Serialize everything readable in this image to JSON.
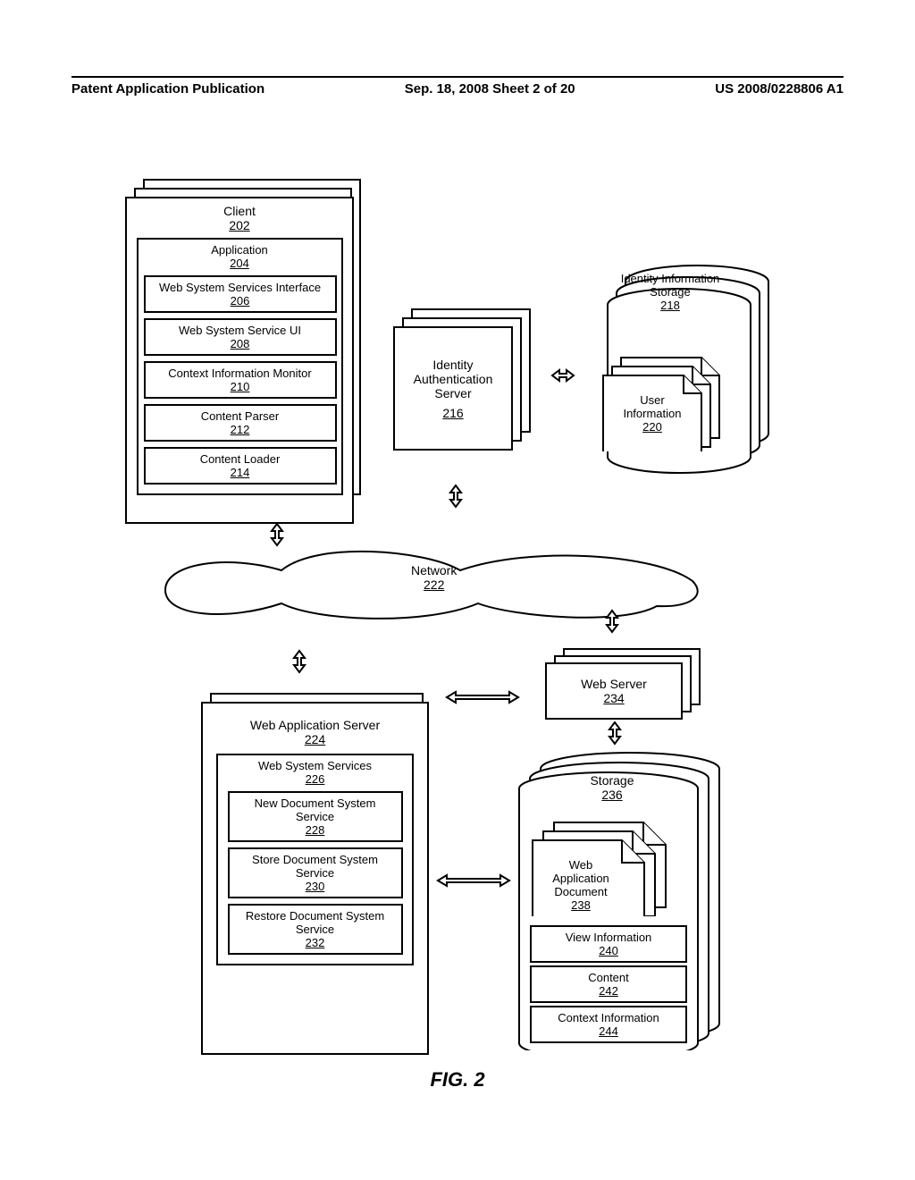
{
  "header": {
    "left": "Patent Application Publication",
    "center": "Sep. 18, 2008  Sheet 2 of 20",
    "right": "US 2008/0228806 A1"
  },
  "client": {
    "title": "Client",
    "num": "202",
    "app": {
      "title": "Application",
      "num": "204"
    },
    "wssi": {
      "title": "Web System Services Interface",
      "num": "206"
    },
    "wssui": {
      "title": "Web System Service UI",
      "num": "208"
    },
    "cim": {
      "title": "Context Information Monitor",
      "num": "210"
    },
    "cp": {
      "title": "Content Parser",
      "num": "212"
    },
    "cl": {
      "title": "Content Loader",
      "num": "214"
    }
  },
  "auth": {
    "title": "Identity Authentication Server",
    "num": "216"
  },
  "idstore": {
    "title": "Identity Information Storage",
    "num": "218",
    "user": {
      "title": "User Information",
      "num": "220"
    }
  },
  "network": {
    "title": "Network",
    "num": "222"
  },
  "was": {
    "title": "Web Application Server",
    "num": "224",
    "wss": {
      "title": "Web System Services",
      "num": "226"
    },
    "new": {
      "title": "New Document System Service",
      "num": "228"
    },
    "store": {
      "title": "Store Document System Service",
      "num": "230"
    },
    "restore": {
      "title": "Restore Document System Service",
      "num": "232"
    }
  },
  "webserver": {
    "title": "Web Server",
    "num": "234"
  },
  "storage": {
    "title": "Storage",
    "num": "236",
    "doc": {
      "title": "Web Application Document",
      "num": "238"
    },
    "view": {
      "title": "View Information",
      "num": "240"
    },
    "content": {
      "title": "Content",
      "num": "242"
    },
    "ctx": {
      "title": "Context Information",
      "num": "244"
    }
  },
  "figure": "FIG. 2"
}
